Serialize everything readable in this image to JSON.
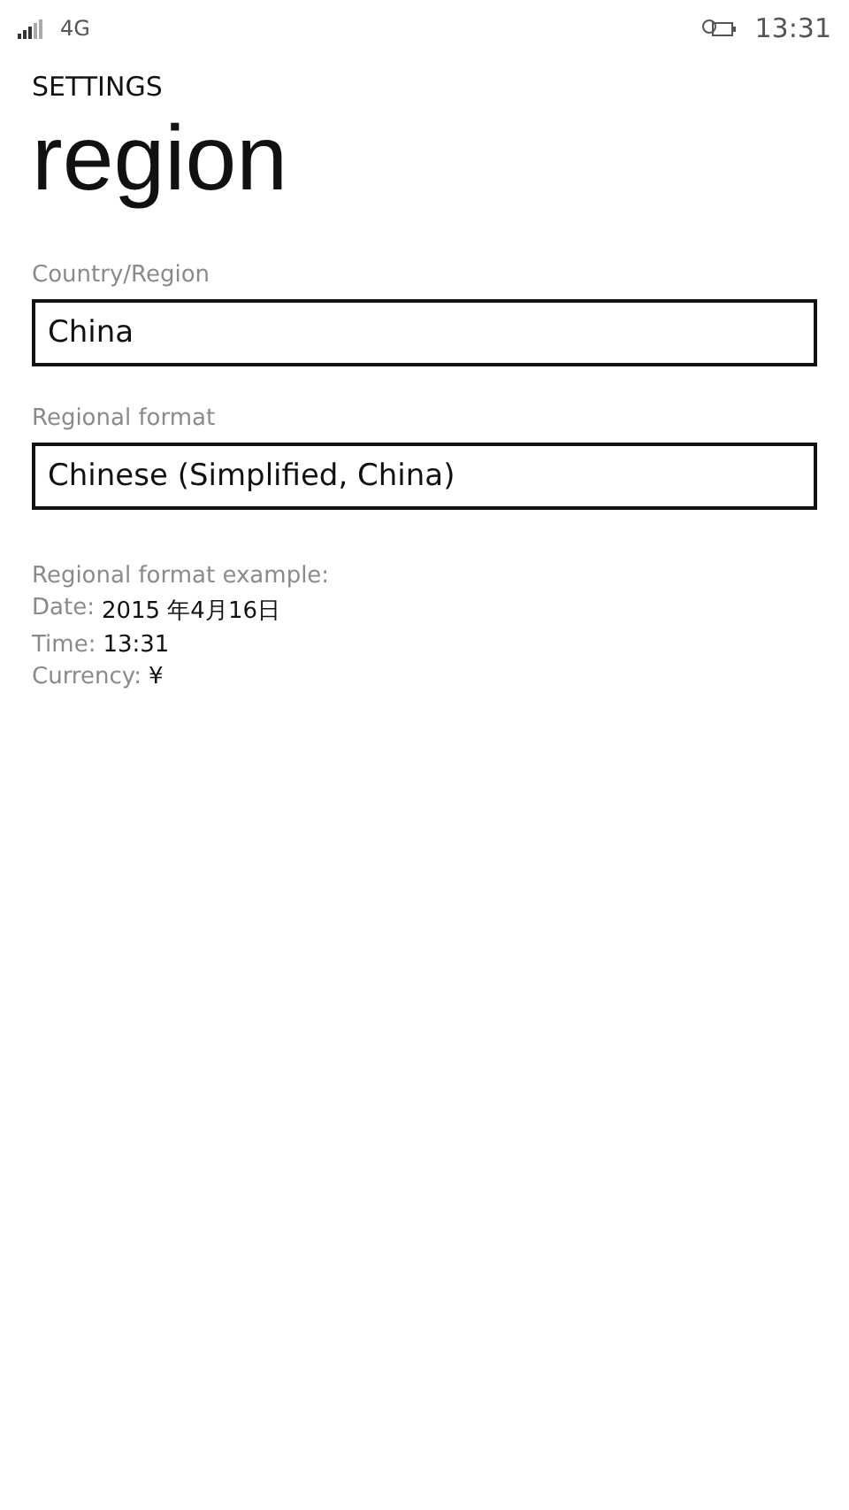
{
  "status_bar": {
    "network": "4G",
    "time": "13:31"
  },
  "header": {
    "app": "SETTINGS",
    "title": "region"
  },
  "fields": [
    {
      "label": "Country/Region",
      "value": "China"
    },
    {
      "label": "Regional format",
      "value": "Chinese (Simplified, China)"
    }
  ],
  "example": {
    "heading": "Regional format example:",
    "rows": [
      {
        "label": "Date:",
        "value": "2015 年4月16日"
      },
      {
        "label": "Time:",
        "value": "13:31"
      },
      {
        "label": "Currency:",
        "value": "¥"
      }
    ]
  }
}
